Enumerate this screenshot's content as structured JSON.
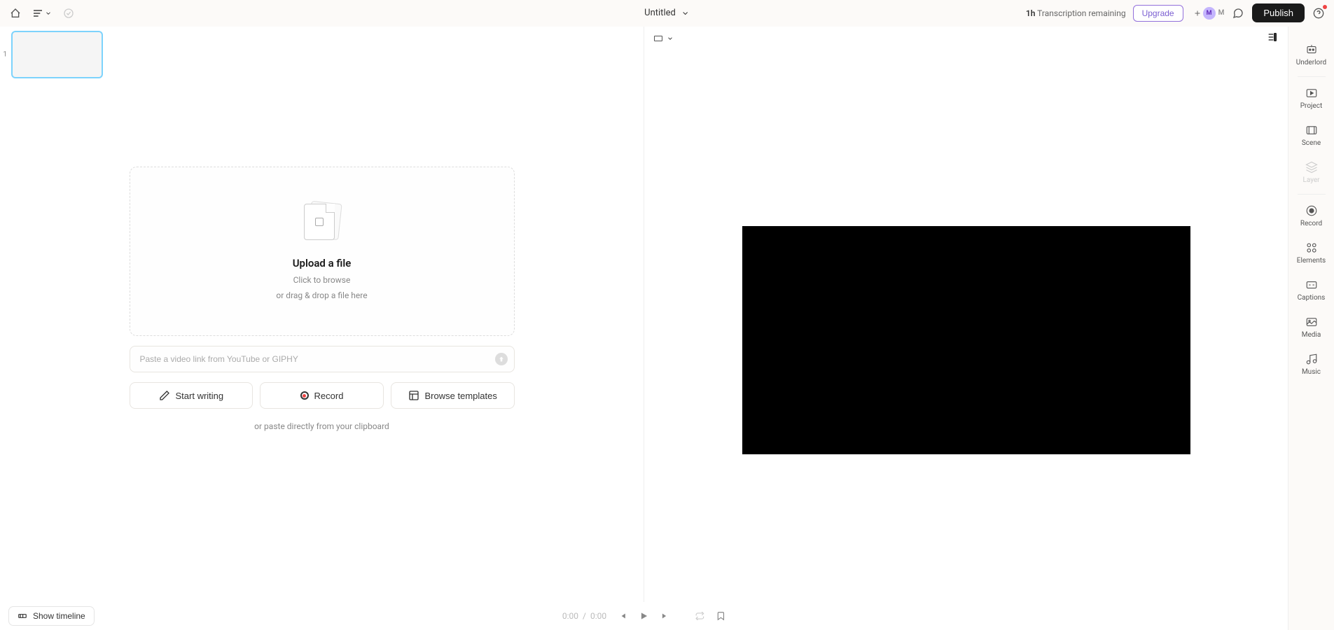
{
  "header": {
    "title": "Untitled",
    "transcription_prefix": "1h",
    "transcription_text": "Transcription remaining",
    "upgrade_label": "Upgrade",
    "publish_label": "Publish",
    "avatar_initial": "M",
    "avatar_letter": "M"
  },
  "scenes": {
    "num1": "1"
  },
  "upload": {
    "title": "Upload a file",
    "sub1": "Click to browse",
    "sub2": "or drag & drop a file here"
  },
  "link_input": {
    "placeholder": "Paste a video link from YouTube or GIPHY"
  },
  "actions": {
    "start_writing": "Start writing",
    "record": "Record",
    "browse_templates": "Browse templates"
  },
  "paste_hint": "or paste directly from your clipboard",
  "rail": {
    "underlord": "Underlord",
    "project": "Project",
    "scene": "Scene",
    "layer": "Layer",
    "record": "Record",
    "elements": "Elements",
    "captions": "Captions",
    "media": "Media",
    "music": "Music"
  },
  "playback": {
    "current": "0:00",
    "separator": "/",
    "total": "0:00"
  },
  "bottom": {
    "show_timeline": "Show timeline"
  }
}
